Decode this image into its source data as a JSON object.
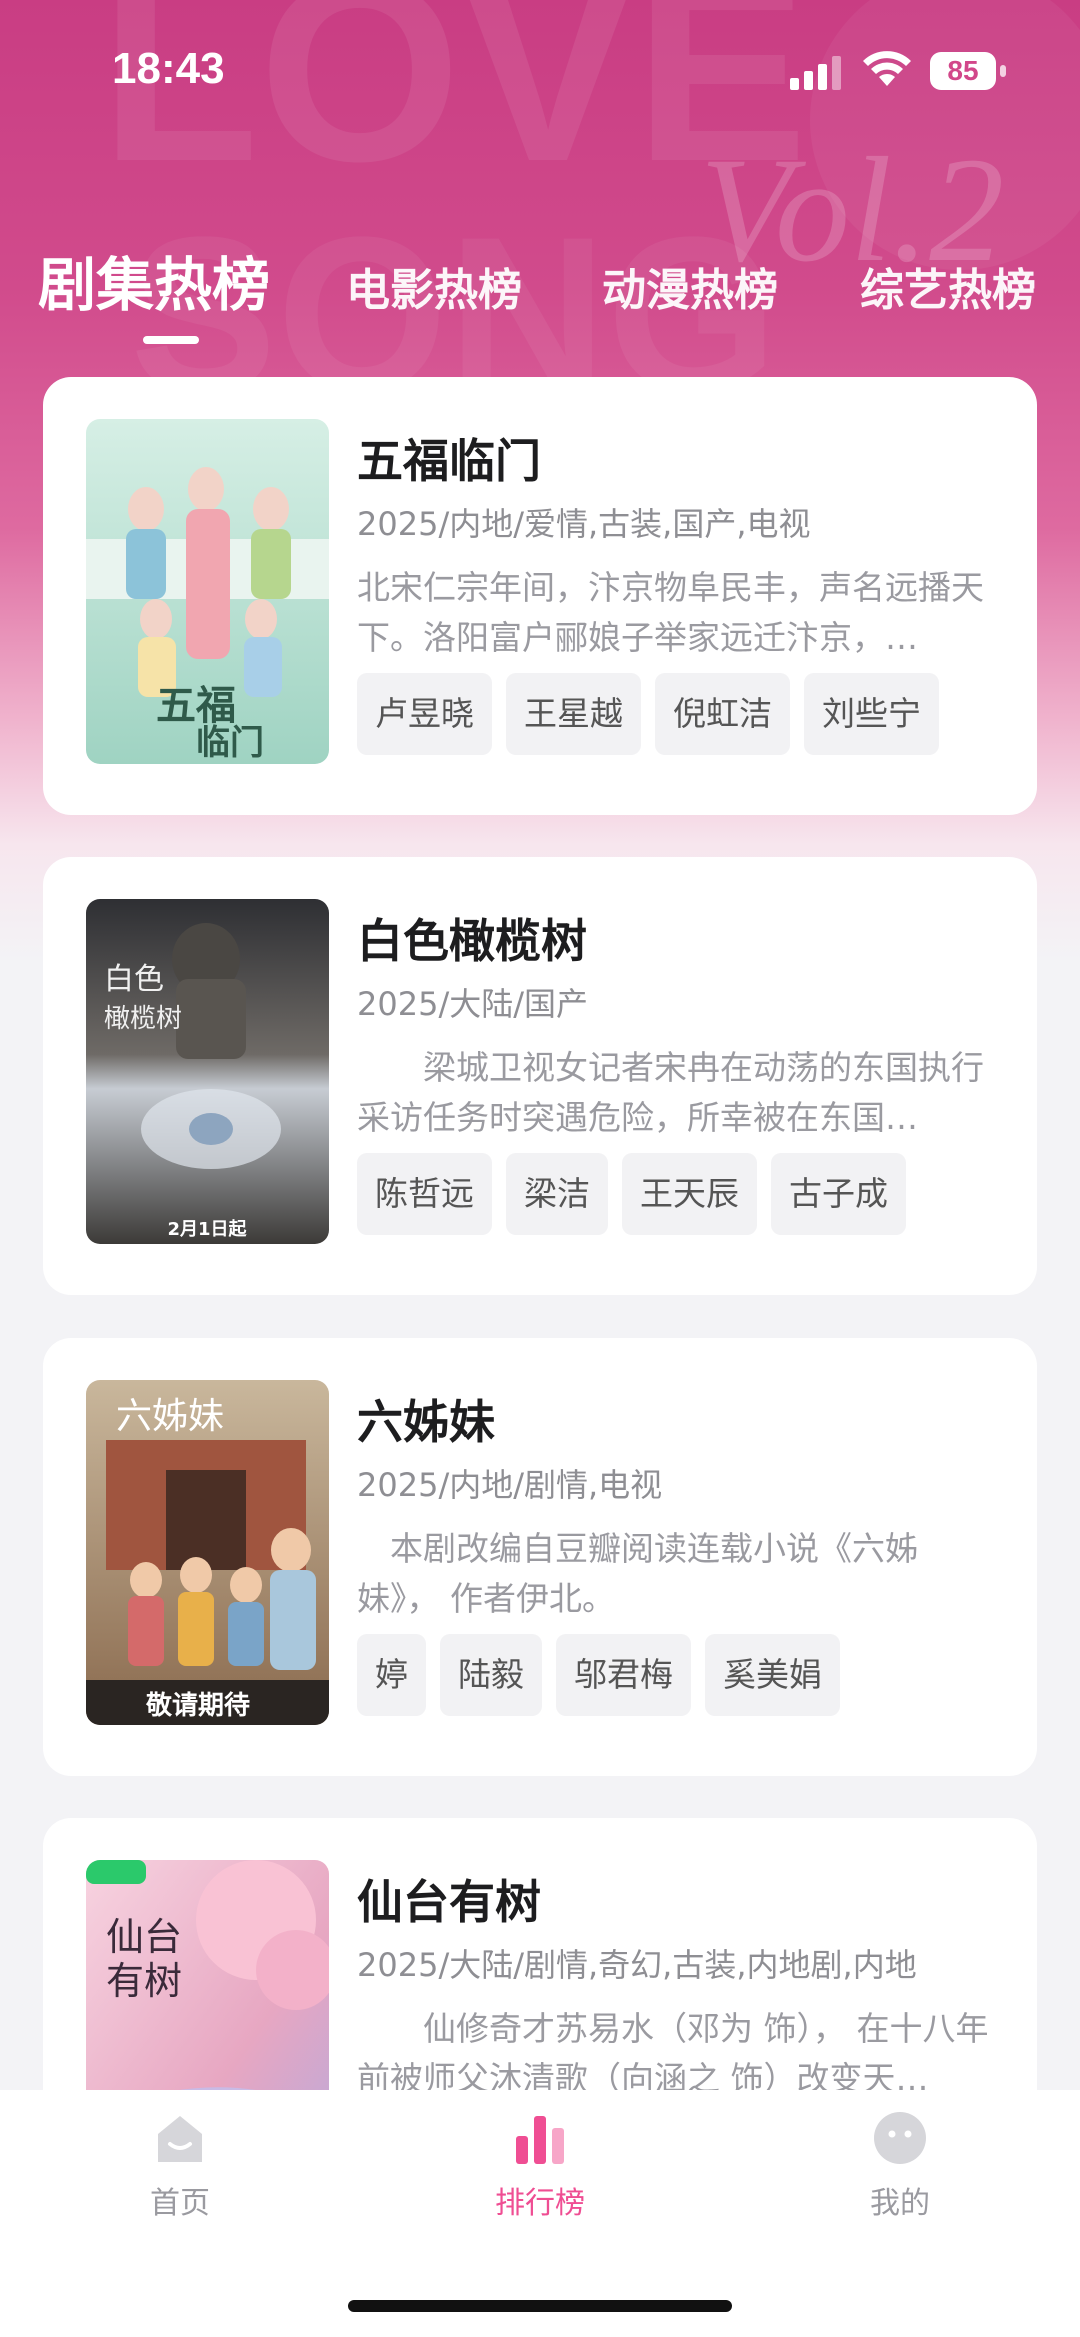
{
  "status_bar": {
    "time": "18:43",
    "battery": "85"
  },
  "tabs": [
    {
      "label": "剧集热榜",
      "active": true
    },
    {
      "label": "电影热榜",
      "active": false
    },
    {
      "label": "动漫热榜",
      "active": false
    },
    {
      "label": "综艺热榜",
      "active": false
    }
  ],
  "cards": [
    {
      "title": "五福临门",
      "meta": "2025/内地/爱情,古装,国产,电视",
      "description": "北宋仁宗年间，汴京物阜民丰，声名远播天下。洛阳富户郦娘子举家远迁汴京，…",
      "tags": [
        "卢昱晓",
        "王星越",
        "倪虹洁",
        "刘些宁"
      ],
      "poster_colors": [
        "#bfe3d6",
        "#e7f2ec",
        "#f1a6b0"
      ]
    },
    {
      "title": "白色橄榄树",
      "meta": "2025/大陆/国产",
      "description": "　　梁城卫视女记者宋冉在动荡的东国执行采访任务时突遇危险，所幸被在东国…",
      "tags": [
        "陈哲远",
        "梁洁",
        "王天辰",
        "古子成"
      ],
      "poster_text": "2月1日起",
      "poster_colors": [
        "#3a3a3e",
        "#8b8f98",
        "#c9cdd4"
      ]
    },
    {
      "title": "六姊妹",
      "meta": "2025/内地/剧情,电视",
      "description": "　本剧改编自豆瓣阅读连载小说《六姊妹》， 作者伊北。",
      "tags": [
        "婷",
        "陆毅",
        "邬君梅",
        "奚美娟"
      ],
      "poster_text": "敬请期待",
      "poster_colors": [
        "#6b4a3a",
        "#c89a6a",
        "#e6d3b5"
      ]
    },
    {
      "title": "仙台有树",
      "meta": "2025/大陆/剧情,奇幻,古装,内地剧,内地",
      "description": "　　仙修奇才苏易水（邓为 饰）， 在十八年前被师父沐清歌（向涵之 饰）改变天…",
      "tags": [],
      "poster_colors": [
        "#f4c6d6",
        "#e9a6c0",
        "#b8a6d8"
      ]
    }
  ],
  "bottom_nav": [
    {
      "label": "首页",
      "icon": "home-icon",
      "active": false
    },
    {
      "label": "排行榜",
      "icon": "ranking-chart-icon",
      "active": true
    },
    {
      "label": "我的",
      "icon": "profile-face-icon",
      "active": false
    }
  ],
  "colors": {
    "accent": "#ef4e93",
    "hero_top": "#c93d83"
  }
}
